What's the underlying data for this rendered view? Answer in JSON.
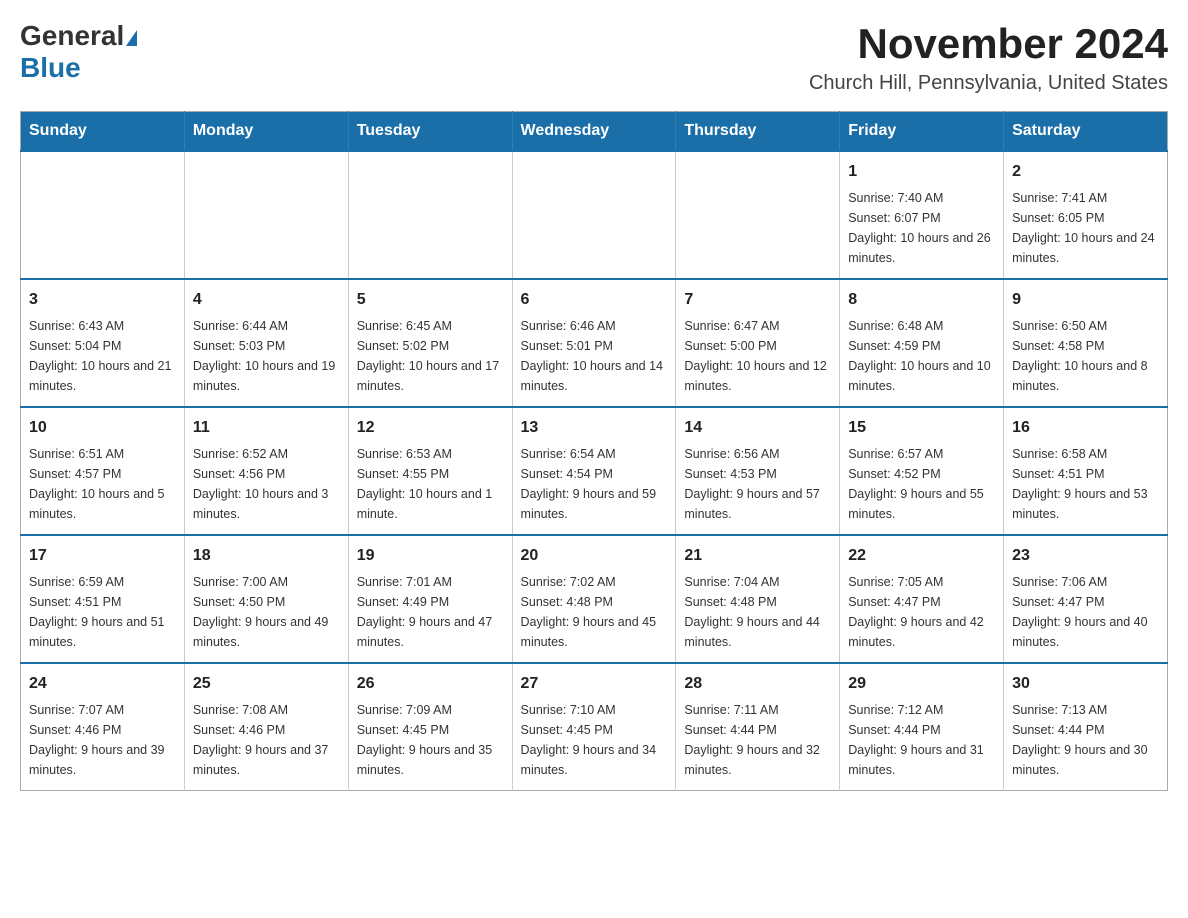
{
  "header": {
    "logo_general": "General",
    "logo_blue": "Blue",
    "calendar_title": "November 2024",
    "calendar_subtitle": "Church Hill, Pennsylvania, United States"
  },
  "days_of_week": [
    "Sunday",
    "Monday",
    "Tuesday",
    "Wednesday",
    "Thursday",
    "Friday",
    "Saturday"
  ],
  "weeks": [
    {
      "days": [
        {
          "number": "",
          "info": ""
        },
        {
          "number": "",
          "info": ""
        },
        {
          "number": "",
          "info": ""
        },
        {
          "number": "",
          "info": ""
        },
        {
          "number": "",
          "info": ""
        },
        {
          "number": "1",
          "info": "Sunrise: 7:40 AM\nSunset: 6:07 PM\nDaylight: 10 hours and 26 minutes."
        },
        {
          "number": "2",
          "info": "Sunrise: 7:41 AM\nSunset: 6:05 PM\nDaylight: 10 hours and 24 minutes."
        }
      ]
    },
    {
      "days": [
        {
          "number": "3",
          "info": "Sunrise: 6:43 AM\nSunset: 5:04 PM\nDaylight: 10 hours and 21 minutes."
        },
        {
          "number": "4",
          "info": "Sunrise: 6:44 AM\nSunset: 5:03 PM\nDaylight: 10 hours and 19 minutes."
        },
        {
          "number": "5",
          "info": "Sunrise: 6:45 AM\nSunset: 5:02 PM\nDaylight: 10 hours and 17 minutes."
        },
        {
          "number": "6",
          "info": "Sunrise: 6:46 AM\nSunset: 5:01 PM\nDaylight: 10 hours and 14 minutes."
        },
        {
          "number": "7",
          "info": "Sunrise: 6:47 AM\nSunset: 5:00 PM\nDaylight: 10 hours and 12 minutes."
        },
        {
          "number": "8",
          "info": "Sunrise: 6:48 AM\nSunset: 4:59 PM\nDaylight: 10 hours and 10 minutes."
        },
        {
          "number": "9",
          "info": "Sunrise: 6:50 AM\nSunset: 4:58 PM\nDaylight: 10 hours and 8 minutes."
        }
      ]
    },
    {
      "days": [
        {
          "number": "10",
          "info": "Sunrise: 6:51 AM\nSunset: 4:57 PM\nDaylight: 10 hours and 5 minutes."
        },
        {
          "number": "11",
          "info": "Sunrise: 6:52 AM\nSunset: 4:56 PM\nDaylight: 10 hours and 3 minutes."
        },
        {
          "number": "12",
          "info": "Sunrise: 6:53 AM\nSunset: 4:55 PM\nDaylight: 10 hours and 1 minute."
        },
        {
          "number": "13",
          "info": "Sunrise: 6:54 AM\nSunset: 4:54 PM\nDaylight: 9 hours and 59 minutes."
        },
        {
          "number": "14",
          "info": "Sunrise: 6:56 AM\nSunset: 4:53 PM\nDaylight: 9 hours and 57 minutes."
        },
        {
          "number": "15",
          "info": "Sunrise: 6:57 AM\nSunset: 4:52 PM\nDaylight: 9 hours and 55 minutes."
        },
        {
          "number": "16",
          "info": "Sunrise: 6:58 AM\nSunset: 4:51 PM\nDaylight: 9 hours and 53 minutes."
        }
      ]
    },
    {
      "days": [
        {
          "number": "17",
          "info": "Sunrise: 6:59 AM\nSunset: 4:51 PM\nDaylight: 9 hours and 51 minutes."
        },
        {
          "number": "18",
          "info": "Sunrise: 7:00 AM\nSunset: 4:50 PM\nDaylight: 9 hours and 49 minutes."
        },
        {
          "number": "19",
          "info": "Sunrise: 7:01 AM\nSunset: 4:49 PM\nDaylight: 9 hours and 47 minutes."
        },
        {
          "number": "20",
          "info": "Sunrise: 7:02 AM\nSunset: 4:48 PM\nDaylight: 9 hours and 45 minutes."
        },
        {
          "number": "21",
          "info": "Sunrise: 7:04 AM\nSunset: 4:48 PM\nDaylight: 9 hours and 44 minutes."
        },
        {
          "number": "22",
          "info": "Sunrise: 7:05 AM\nSunset: 4:47 PM\nDaylight: 9 hours and 42 minutes."
        },
        {
          "number": "23",
          "info": "Sunrise: 7:06 AM\nSunset: 4:47 PM\nDaylight: 9 hours and 40 minutes."
        }
      ]
    },
    {
      "days": [
        {
          "number": "24",
          "info": "Sunrise: 7:07 AM\nSunset: 4:46 PM\nDaylight: 9 hours and 39 minutes."
        },
        {
          "number": "25",
          "info": "Sunrise: 7:08 AM\nSunset: 4:46 PM\nDaylight: 9 hours and 37 minutes."
        },
        {
          "number": "26",
          "info": "Sunrise: 7:09 AM\nSunset: 4:45 PM\nDaylight: 9 hours and 35 minutes."
        },
        {
          "number": "27",
          "info": "Sunrise: 7:10 AM\nSunset: 4:45 PM\nDaylight: 9 hours and 34 minutes."
        },
        {
          "number": "28",
          "info": "Sunrise: 7:11 AM\nSunset: 4:44 PM\nDaylight: 9 hours and 32 minutes."
        },
        {
          "number": "29",
          "info": "Sunrise: 7:12 AM\nSunset: 4:44 PM\nDaylight: 9 hours and 31 minutes."
        },
        {
          "number": "30",
          "info": "Sunrise: 7:13 AM\nSunset: 4:44 PM\nDaylight: 9 hours and 30 minutes."
        }
      ]
    }
  ]
}
